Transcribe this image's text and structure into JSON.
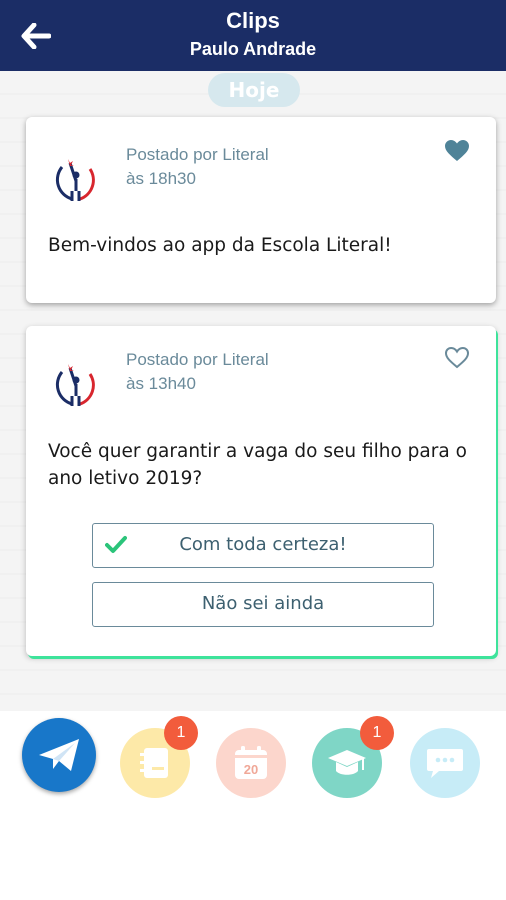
{
  "header": {
    "title": "Clips",
    "subtitle": "Paulo Andrade"
  },
  "feed": {
    "date_label": "Hoje",
    "posts": [
      {
        "posted_by": "Postado por Literal",
        "time": "às 18h30",
        "message": "Bem-vindos ao app da Escola Literal!",
        "liked": true
      },
      {
        "posted_by": "Postado por Literal",
        "time": "às 13h40",
        "message": "Você quer garantir a vaga do seu filho para o ano letivo 2019?",
        "liked": false,
        "options": [
          {
            "label": "Com toda certeza!",
            "selected": true
          },
          {
            "label": "Não sei ainda",
            "selected": false
          }
        ]
      }
    ]
  },
  "bottom_nav": {
    "items": [
      {
        "icon": "paper-plane-icon",
        "color": "#1877c9"
      },
      {
        "icon": "notebook-icon",
        "color": "#fde9a8",
        "badge": "1"
      },
      {
        "icon": "calendar-icon",
        "color": "#fcd6cc",
        "calendar_day": "20"
      },
      {
        "icon": "graduation-cap-icon",
        "color": "#7fd6c6",
        "badge": "1"
      },
      {
        "icon": "chat-bubble-icon",
        "color": "#c7ecf7"
      }
    ]
  },
  "colors": {
    "header_bg": "#1b2d66",
    "accent_green": "#3ee39b",
    "badge": "#f25c3c",
    "meta_text": "#6a8a9a"
  }
}
